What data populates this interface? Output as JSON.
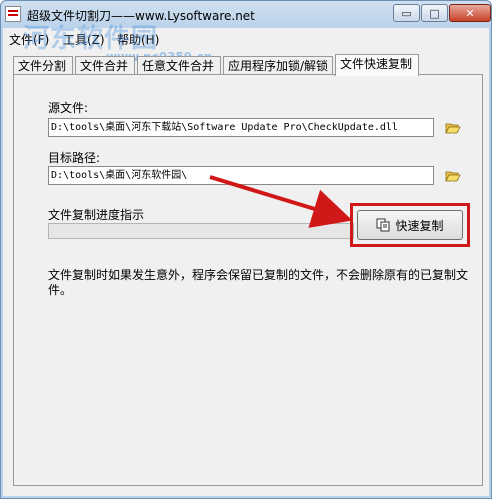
{
  "window": {
    "title": "超级文件切割刀——www.Lysoftware.net"
  },
  "title_controls": {
    "minimize": "▭",
    "maximize": "□",
    "close": "✕"
  },
  "menu": {
    "items": [
      "文件(F)",
      "工具(Z)",
      "帮助(H)"
    ]
  },
  "watermark": {
    "text": "河东软件园",
    "url": "www.pc0359.cn"
  },
  "tabs": [
    "文件分割",
    "文件合并",
    "任意文件合并",
    "应用程序加锁/解锁",
    "文件快速复制"
  ],
  "active_tab": "文件快速复制",
  "form": {
    "source_label": "源文件:",
    "source_value": "D:\\tools\\桌面\\河东下载站\\Software Update Pro\\CheckUpdate.dll",
    "target_label": "目标路径:",
    "target_value": "D:\\tools\\桌面\\河东软件园\\",
    "progress_label": "文件复制进度指示",
    "progress_value": 0,
    "copy_button": "快速复制",
    "note": "文件复制时如果发生意外，程序会保留已复制的文件，不会删除原有的已复制文件。"
  },
  "colors": {
    "highlight": "#d11818",
    "arrow": "#d11818",
    "watermark": "#3c8cdc"
  },
  "icons": [
    "app-icon",
    "folder-open-icon",
    "copy-icon"
  ]
}
